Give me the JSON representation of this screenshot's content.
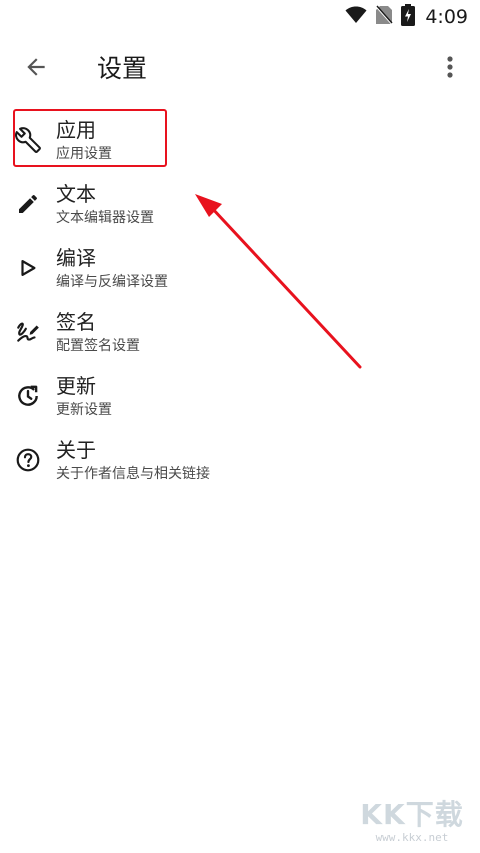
{
  "status_bar": {
    "time": "4:09",
    "icons": [
      "wifi-icon",
      "no-sim-icon",
      "battery-charging-icon"
    ]
  },
  "app_bar": {
    "title": "设置",
    "back_icon": "arrow-back-icon",
    "menu_icon": "more-vert-icon"
  },
  "settings_items": [
    {
      "icon": "wrench-icon",
      "title": "应用",
      "subtitle": "应用设置"
    },
    {
      "icon": "pencil-icon",
      "title": "文本",
      "subtitle": "文本编辑器设置"
    },
    {
      "icon": "play-outline-icon",
      "title": "编译",
      "subtitle": "编译与反编译设置"
    },
    {
      "icon": "signature-icon",
      "title": "签名",
      "subtitle": "配置签名设置"
    },
    {
      "icon": "update-icon",
      "title": "更新",
      "subtitle": "更新设置"
    },
    {
      "icon": "help-circle-icon",
      "title": "关于",
      "subtitle": "关于作者信息与相关链接"
    }
  ],
  "annotation": {
    "color": "#e8121e"
  },
  "watermark": {
    "logo": "KK下载",
    "url": "www.kkx.net"
  }
}
